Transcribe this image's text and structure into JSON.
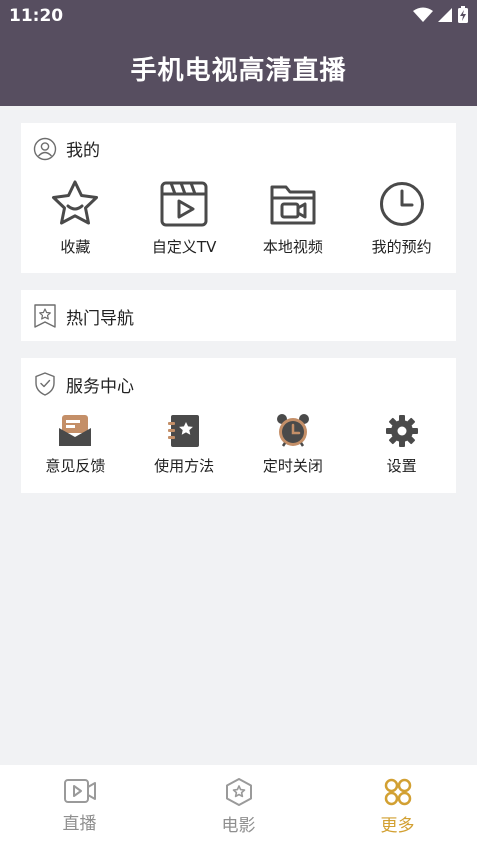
{
  "status_bar": {
    "time": "11:20"
  },
  "header": {
    "title": "手机电视高清直播"
  },
  "mine": {
    "title": "我的",
    "items": [
      {
        "label": "收藏",
        "icon": "star-icon"
      },
      {
        "label": "自定义TV",
        "icon": "clapperboard-icon"
      },
      {
        "label": "本地视频",
        "icon": "folder-video-icon"
      },
      {
        "label": "我的预约",
        "icon": "clock-icon"
      }
    ]
  },
  "hot_nav": {
    "title": "热门导航"
  },
  "service": {
    "title": "服务中心",
    "items": [
      {
        "label": "意见反馈",
        "icon": "feedback-icon"
      },
      {
        "label": "使用方法",
        "icon": "manual-icon"
      },
      {
        "label": "定时关闭",
        "icon": "alarm-clock-icon"
      },
      {
        "label": "设置",
        "icon": "gear-icon"
      }
    ]
  },
  "tabbar": {
    "tabs": [
      {
        "label": "直播",
        "icon": "video-camera-icon"
      },
      {
        "label": "电影",
        "icon": "movie-hexagon-icon"
      },
      {
        "label": "更多",
        "icon": "more-grid-icon"
      }
    ],
    "active_index": 2
  },
  "colors": {
    "header_bg": "#574e60",
    "accent": "#d2a032",
    "page_bg": "#f1f2f4"
  }
}
